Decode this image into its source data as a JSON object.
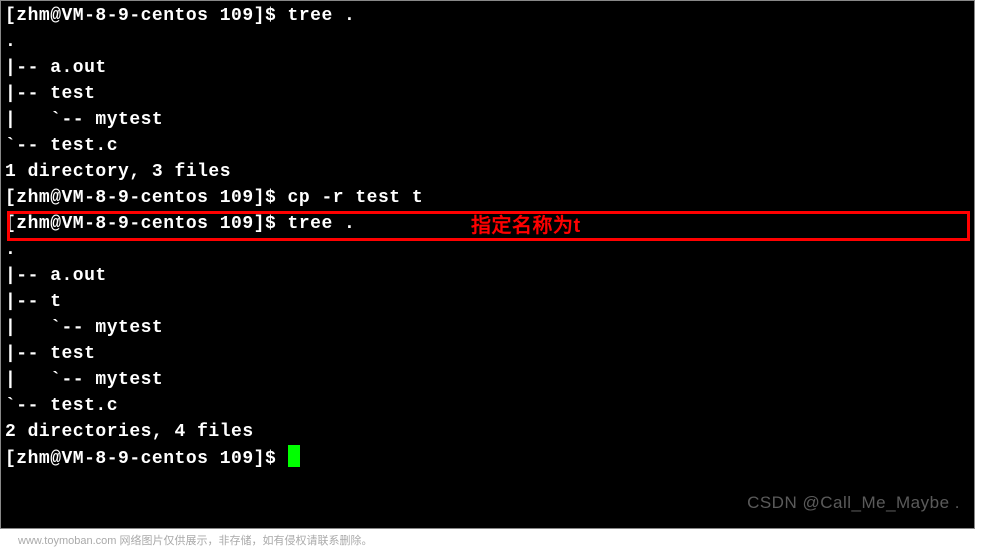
{
  "terminal": {
    "lines": [
      "[zhm@VM-8-9-centos 109]$ tree .",
      ".",
      "|-- a.out",
      "|-- test",
      "|   `-- mytest",
      "`-- test.c",
      "",
      "1 directory, 3 files",
      "[zhm@VM-8-9-centos 109]$ cp -r test t",
      "[zhm@VM-8-9-centos 109]$ tree .",
      ".",
      "|-- a.out",
      "|-- t",
      "|   `-- mytest",
      "|-- test",
      "|   `-- mytest",
      "`-- test.c",
      "",
      "2 directories, 4 files",
      "[zhm@VM-8-9-centos 109]$ "
    ]
  },
  "annotation": "指定名称为t",
  "watermark_bottom": "www.toymoban.com  网络图片仅供展示，非存储，如有侵权请联系删除。",
  "watermark_csdn": "CSDN @Call_Me_Maybe ."
}
